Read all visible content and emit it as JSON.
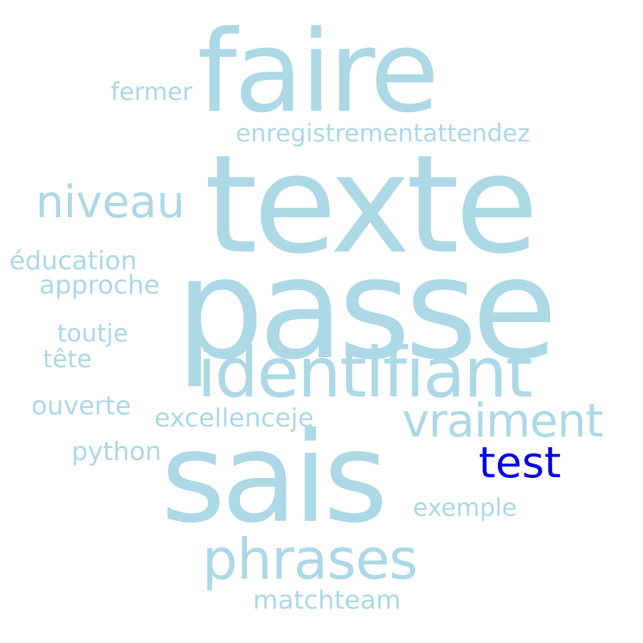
{
  "colors": {
    "default_word": "#add8e6",
    "highlight_word": "#0000ee",
    "background": "#ffffff"
  },
  "words": [
    {
      "key": "faire",
      "text": "faire",
      "color": "#add8e6"
    },
    {
      "key": "fermer",
      "text": "fermer",
      "color": "#add8e6"
    },
    {
      "key": "enregistrementattendez",
      "text": "enregistrementattendez",
      "color": "#add8e6"
    },
    {
      "key": "texte",
      "text": "texte",
      "color": "#add8e6"
    },
    {
      "key": "niveau",
      "text": "niveau",
      "color": "#add8e6"
    },
    {
      "key": "passe",
      "text": "passe",
      "color": "#add8e6"
    },
    {
      "key": "education",
      "text": "éducation",
      "color": "#add8e6"
    },
    {
      "key": "approche",
      "text": "approche",
      "color": "#add8e6"
    },
    {
      "key": "toutje",
      "text": "toutje",
      "color": "#add8e6"
    },
    {
      "key": "tete",
      "text": "tête",
      "color": "#add8e6"
    },
    {
      "key": "identifiant",
      "text": "identifiant",
      "color": "#add8e6"
    },
    {
      "key": "ouverte",
      "text": "ouverte",
      "color": "#add8e6"
    },
    {
      "key": "excellenceje",
      "text": "excellenceje",
      "color": "#add8e6"
    },
    {
      "key": "vraiment",
      "text": "vraiment",
      "color": "#add8e6"
    },
    {
      "key": "python",
      "text": "python",
      "color": "#add8e6"
    },
    {
      "key": "sais",
      "text": "sais",
      "color": "#add8e6"
    },
    {
      "key": "test",
      "text": "test",
      "color": "#0000ee"
    },
    {
      "key": "exemple",
      "text": "exemple",
      "color": "#add8e6"
    },
    {
      "key": "phrases",
      "text": "phrases",
      "color": "#add8e6"
    },
    {
      "key": "matchteam",
      "text": "matchteam",
      "color": "#add8e6"
    }
  ]
}
